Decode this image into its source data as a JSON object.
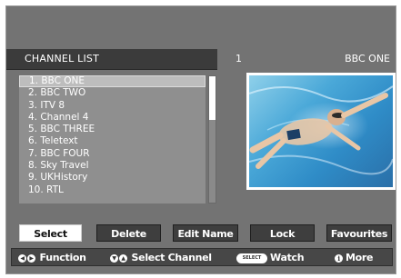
{
  "header": {
    "title": "CHANNEL LIST",
    "current_channel_number": "1",
    "current_channel_name": "BBC ONE"
  },
  "channels": [
    {
      "label": "1. BBC ONE"
    },
    {
      "label": "2. BBC TWO"
    },
    {
      "label": "3. ITV 8"
    },
    {
      "label": "4. Channel 4"
    },
    {
      "label": "5. BBC THREE"
    },
    {
      "label": "6. Teletext"
    },
    {
      "label": "7. BBC FOUR"
    },
    {
      "label": "8. Sky Travel"
    },
    {
      "label": "9. UKHistory"
    },
    {
      "label": "10. RTL"
    }
  ],
  "selected_channel_index": 0,
  "buttons": {
    "select": "Select",
    "delete": "Delete",
    "edit_name": "Edit Name",
    "lock": "Lock",
    "favourites": "Favourites"
  },
  "legend": {
    "function": "Function",
    "select_channel": "Select Channel",
    "select_key": "SELECT",
    "watch": "Watch",
    "more": "More"
  },
  "colors": {
    "screen_bg": "#737373",
    "header_bg": "#3b3b3b",
    "button_bg": "#3e3e3e",
    "active_button_bg": "#ffffff",
    "selected_row": "#bdbdbd"
  }
}
